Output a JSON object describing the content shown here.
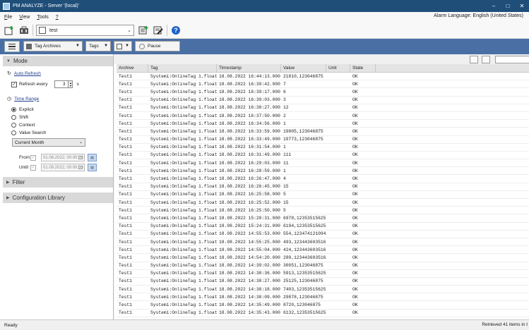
{
  "window": {
    "title": "PM ANALYZE - Server '(local)'"
  },
  "menu": {
    "items": [
      {
        "label": "File",
        "ul": "F",
        "rest": "ile"
      },
      {
        "label": "View",
        "ul": "V",
        "rest": "iew"
      },
      {
        "label": "Tools",
        "ul": "T",
        "rest": "ools"
      },
      {
        "label": "?",
        "ul": "?",
        "rest": ""
      }
    ],
    "alarm_language": "Alarm Language: English (United States)"
  },
  "toolbar": {
    "project_value": "test"
  },
  "viewbar": {
    "view_type": "Tag Archives",
    "tags_label": "Tags",
    "pause_label": "Pause"
  },
  "left": {
    "mode_header": "Mode",
    "auto_refresh_link": "Auto Refresh",
    "refresh_every_label": "Refresh every",
    "refresh_value": "3",
    "refresh_unit": "s",
    "time_range_link": "Time Range",
    "time_options": [
      "Explicit",
      "Shift",
      "Context",
      "Value Search"
    ],
    "selected_time_option": "Explicit",
    "preset_value": "Current Month",
    "from_label": "From",
    "from_value": "01.08.2022; 00:00:00",
    "until_label": "Until",
    "until_value": "01.09.2022; 00:00:00",
    "filter_header": "Filter",
    "config_header": "Configuration Library"
  },
  "table": {
    "columns": [
      "Archive",
      "Tag",
      "Timestamp",
      "Value",
      "Unit",
      "State"
    ],
    "rows": [
      [
        "Test1",
        "Systemi:OnlineTag 1.float",
        "18.08.2022 16:44:13.000",
        "21810,123046875",
        "",
        "OK"
      ],
      [
        "Test1",
        "Systemi:OnlineTag 1.float",
        "18.08.2022 16:39:42.000",
        "7",
        "",
        "OK"
      ],
      [
        "Test1",
        "Systemi:OnlineTag 1.float",
        "18.08.2022 16:39:17.000",
        "6",
        "",
        "OK"
      ],
      [
        "Test1",
        "Systemi:OnlineTag 1.float",
        "18.08.2022 16:39:03.000",
        "3",
        "",
        "OK"
      ],
      [
        "Test1",
        "Systemi:OnlineTag 1.float",
        "18.08.2022 16:38:27.000",
        "12",
        "",
        "OK"
      ],
      [
        "Test1",
        "Systemi:OnlineTag 1.float",
        "18.08.2022 16:37:50.000",
        "2",
        "",
        "OK"
      ],
      [
        "Test1",
        "Systemi:OnlineTag 1.float",
        "18.08.2022 16:34:56.000",
        "1",
        "",
        "OK"
      ],
      [
        "Test1",
        "Systemi:OnlineTag 1.float",
        "18.08.2022 16:33:59.000",
        "19805,123046875",
        "",
        "OK"
      ],
      [
        "Test1",
        "Systemi:OnlineTag 1.float",
        "18.08.2022 16:33:49.000",
        "19773,123046875",
        "",
        "OK"
      ],
      [
        "Test1",
        "Systemi:OnlineTag 1.float",
        "18.08.2022 16:31:54.000",
        "1",
        "",
        "OK"
      ],
      [
        "Test1",
        "Systemi:OnlineTag 1.float",
        "18.08.2022 16:31:49.000",
        "111",
        "",
        "OK"
      ],
      [
        "Test1",
        "Systemi:OnlineTag 1.float",
        "18.08.2022 16:29:03.000",
        "11",
        "",
        "OK"
      ],
      [
        "Test1",
        "Systemi:OnlineTag 1.float",
        "18.08.2022 16:28:59.000",
        "1",
        "",
        "OK"
      ],
      [
        "Test1",
        "Systemi:OnlineTag 1.float",
        "18.08.2022 16:26:47.000",
        "4",
        "",
        "OK"
      ],
      [
        "Test1",
        "Systemi:OnlineTag 1.float",
        "18.08.2022 16:26:45.000",
        "15",
        "",
        "OK"
      ],
      [
        "Test1",
        "Systemi:OnlineTag 1.float",
        "18.08.2022 16:25:58.000",
        "5",
        "",
        "OK"
      ],
      [
        "Test1",
        "Systemi:OnlineTag 1.float",
        "18.08.2022 16:25:52.000",
        "15",
        "",
        "OK"
      ],
      [
        "Test1",
        "Systemi:OnlineTag 1.float",
        "18.08.2022 16:25:50.000",
        "5",
        "",
        "OK"
      ],
      [
        "Test1",
        "Systemi:OnlineTag 1.float",
        "18.08.2022 15:28:31.000",
        "6978,12353515625",
        "",
        "OK"
      ],
      [
        "Test1",
        "Systemi:OnlineTag 1.float",
        "18.08.2022 15:24:31.000",
        "6194,12353515625",
        "",
        "OK"
      ],
      [
        "Test1",
        "Systemi:OnlineTag 1.float",
        "18.08.2022 14:55:53.000",
        "554,123474121094",
        "",
        "OK"
      ],
      [
        "Test1",
        "Systemi:OnlineTag 1.float",
        "18.08.2022 14:55:25.000",
        "493,123443603516",
        "",
        "OK"
      ],
      [
        "Test1",
        "Systemi:OnlineTag 1.float",
        "18.08.2022 14:55:04.000",
        "424,123443603516",
        "",
        "OK"
      ],
      [
        "Test1",
        "Systemi:OnlineTag 1.float",
        "18.08.2022 14:54:20.000",
        "280,123443603516",
        "",
        "OK"
      ],
      [
        "Test1",
        "Systemi:OnlineTag 1.float",
        "18.08.2022 14:39:02.000",
        "30051,123046875",
        "",
        "OK"
      ],
      [
        "Test1",
        "Systemi:OnlineTag 1.float",
        "18.08.2022 14:38:36.000",
        "5913,12353515625",
        "",
        "OK"
      ],
      [
        "Test1",
        "Systemi:OnlineTag 1.float",
        "18.08.2022 14:38:27.000",
        "25125,123046875",
        "",
        "OK"
      ],
      [
        "Test1",
        "Systemi:OnlineTag 1.float",
        "18.08.2022 14:38:18.000",
        "7403,12353515625",
        "",
        "OK"
      ],
      [
        "Test1",
        "Systemi:OnlineTag 1.float",
        "18.08.2022 14:38:09.000",
        "29878,123046875",
        "",
        "OK"
      ],
      [
        "Test1",
        "Systemi:OnlineTag 1.float",
        "18.08.2022 14:35:49.000",
        "8720,123046875",
        "",
        "OK"
      ],
      [
        "Test1",
        "Systemi:OnlineTag 1.float",
        "18.08.2022 14:35:43.000",
        "6132,12353515625",
        "",
        "OK"
      ]
    ]
  },
  "status": {
    "left": "Ready",
    "right": "Retrieved 41 items in t"
  },
  "colors": {
    "titlebar": "#1f4e79",
    "viewbar": "#4a6fa5"
  }
}
